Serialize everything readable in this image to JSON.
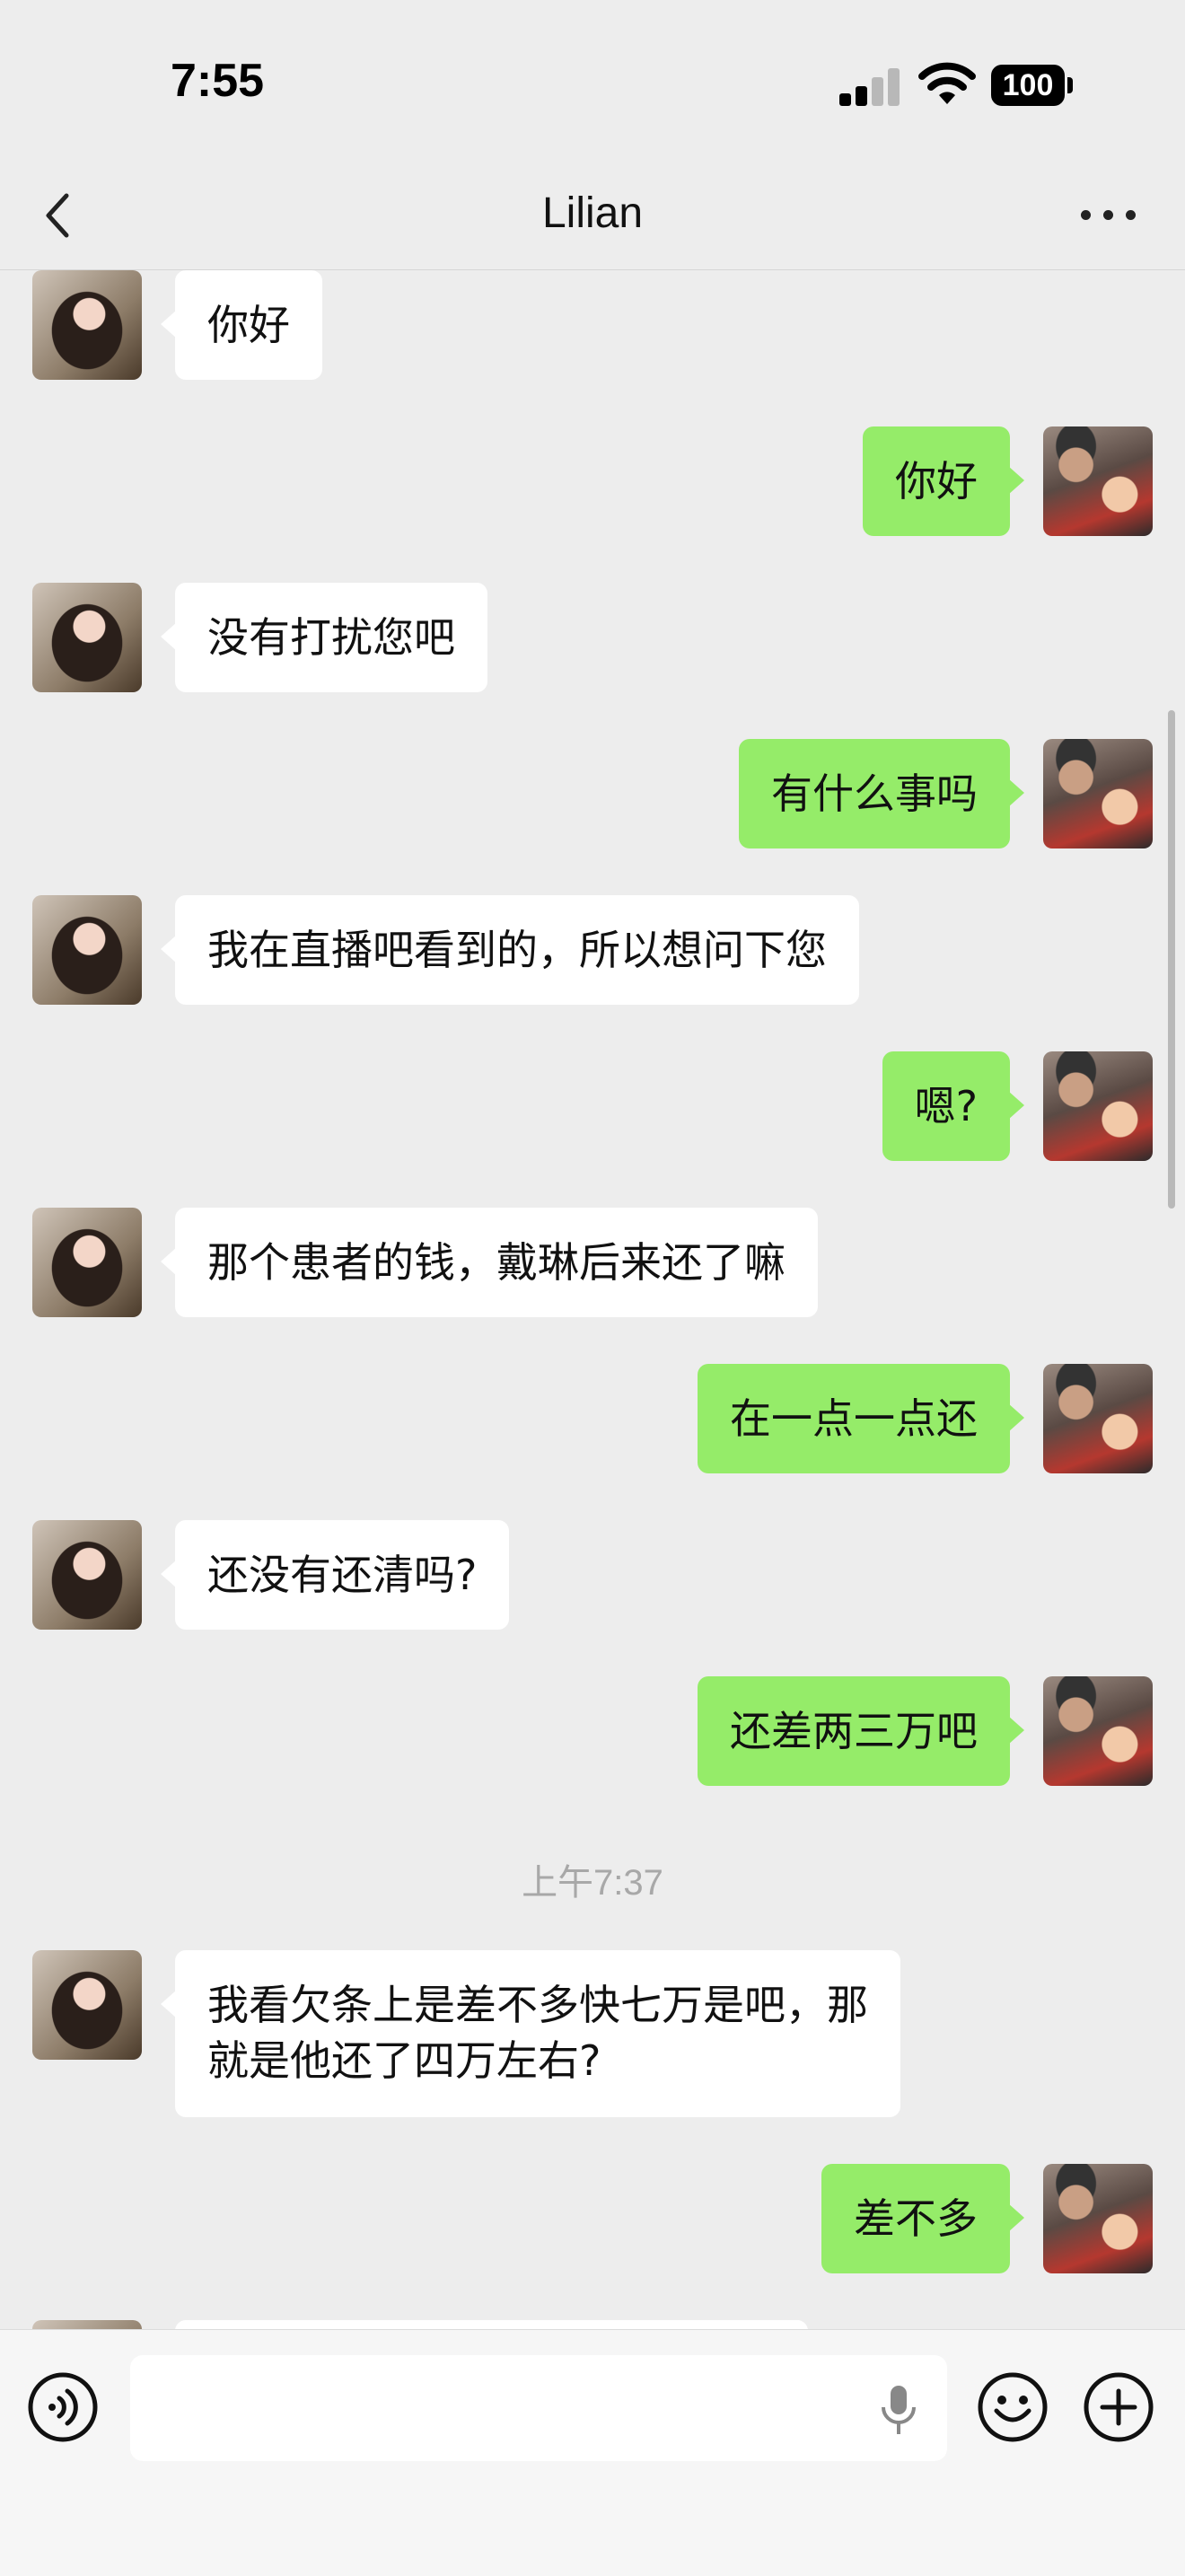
{
  "status": {
    "time": "7:55",
    "battery": "100"
  },
  "nav": {
    "title": "Lilian",
    "back_icon": "back-chevron-icon",
    "more_icon": "more-dots-icon"
  },
  "messages": [
    {
      "side": "in",
      "text": "你好"
    },
    {
      "side": "out",
      "text": "你好"
    },
    {
      "side": "in",
      "text": "没有打扰您吧"
    },
    {
      "side": "out",
      "text": "有什么事吗"
    },
    {
      "side": "in",
      "text": "我在直播吧看到的，所以想问下您"
    },
    {
      "side": "out",
      "text": "嗯?"
    },
    {
      "side": "in",
      "text": "那个患者的钱，戴琳后来还了嘛"
    },
    {
      "side": "out",
      "text": "在一点一点还"
    },
    {
      "side": "in",
      "text": "还没有还清吗?"
    },
    {
      "side": "out",
      "text": "还差两三万吧"
    },
    {
      "side": "in",
      "text": "我看欠条上是差不多快七万是吧，那",
      "text2": "就是他还了四万左右?"
    },
    {
      "side": "out",
      "text": "差不多"
    }
  ],
  "timestamp": "上午7:37",
  "input": {
    "placeholder": "",
    "voice_icon": "voice-icon",
    "mic_icon": "microphone-icon",
    "emoji_icon": "emoji-icon",
    "plus_icon": "plus-icon"
  },
  "colors": {
    "background": "#ededed",
    "outgoing_bubble": "#95ec69",
    "incoming_bubble": "#ffffff"
  }
}
